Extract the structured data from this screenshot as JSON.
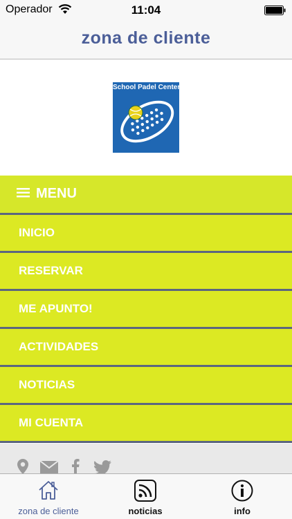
{
  "status_bar": {
    "carrier": "Operador",
    "time": "11:04",
    "wifi_icon": "wifi-icon",
    "battery_icon": "battery-icon"
  },
  "nav": {
    "title": "zona de cliente"
  },
  "logo": {
    "text": "School Padel Center"
  },
  "menu": {
    "header_label": "MENU",
    "items": [
      {
        "label": "INICIO"
      },
      {
        "label": "RESERVAR"
      },
      {
        "label": "ME APUNTO!"
      },
      {
        "label": "ACTIVIDADES"
      },
      {
        "label": "NOTICIAS"
      },
      {
        "label": "MI CUENTA"
      }
    ]
  },
  "social_icons": [
    "map-pin-icon",
    "mail-icon",
    "facebook-icon",
    "twitter-icon"
  ],
  "tab_bar": {
    "tabs": [
      {
        "label": "zona de cliente",
        "icon": "home-icon",
        "active": true
      },
      {
        "label": "noticias",
        "icon": "rss-icon",
        "active": false
      },
      {
        "label": "info",
        "icon": "info-icon",
        "active": false
      }
    ]
  },
  "colors": {
    "menu_background": "#dce923",
    "menu_divider": "#5b6680",
    "title_color": "#4b5e98",
    "logo_blue": "#1f67b3"
  }
}
